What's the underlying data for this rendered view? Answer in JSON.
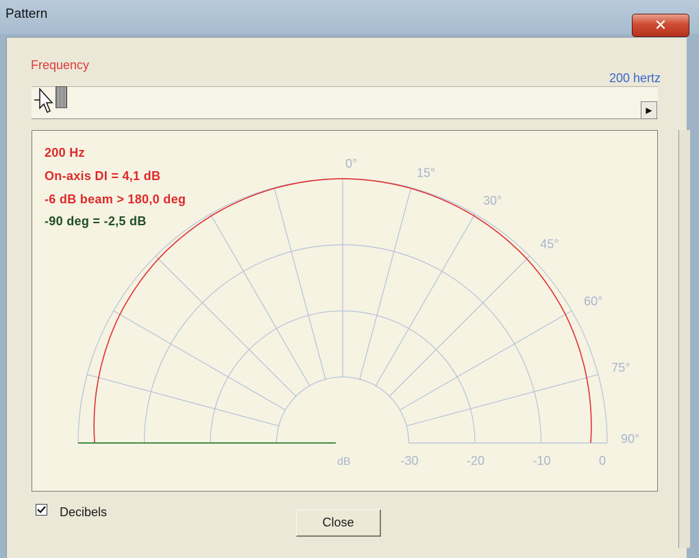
{
  "window": {
    "title": "Pattern",
    "close_glyph": "✕"
  },
  "frequency": {
    "label": "Frequency",
    "value_text": "200 hertz",
    "slider_position": 0.04
  },
  "info": {
    "line1": "200 Hz",
    "line2": "On-axis DI = 4,1 dB",
    "line3": "-6 dB beam > 180,0 deg",
    "line4": "-90 deg = -2,5 dB"
  },
  "chart_data": {
    "type": "polar",
    "angle_labels": [
      "0°",
      "15°",
      "30°",
      "45°",
      "60°",
      "75°",
      "90°"
    ],
    "angles_deg": [
      0,
      15,
      30,
      45,
      60,
      75,
      90
    ],
    "radial_unit_label": "dB",
    "radial_tick_labels": [
      "-30",
      "-20",
      "-10",
      "0"
    ],
    "radial_range_db": [
      -40,
      0
    ],
    "series": [
      {
        "color": "#e03030",
        "angles_deg": [
          0,
          15,
          30,
          45,
          60,
          75,
          90
        ],
        "values_db": [
          0.0,
          -0.1,
          -0.3,
          -0.6,
          -1.1,
          -1.8,
          -2.5
        ]
      }
    ],
    "colors": {
      "grid": "#b4c3d6",
      "pattern": "#e03030",
      "baseline": "#2e7d32",
      "tick_text": "#a8b7c9"
    }
  },
  "footer": {
    "decibels_label": "Decibels",
    "decibels_checked": true,
    "close_label": "Close"
  }
}
